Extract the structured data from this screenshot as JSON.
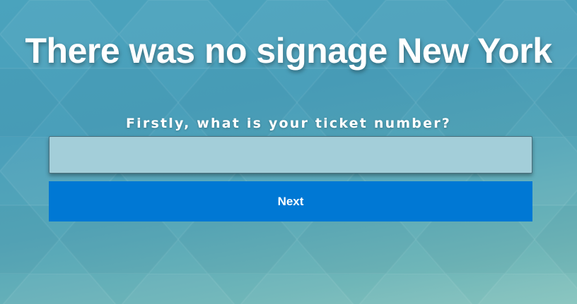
{
  "page": {
    "title": "There was no signage New York"
  },
  "form": {
    "question": "Firstly, what is your ticket number?",
    "ticket_input": {
      "value": "",
      "placeholder": ""
    },
    "next_label": "Next"
  },
  "colors": {
    "background": "#4aa3bd",
    "input_background": "#a3ced9",
    "button": "#0078d4",
    "text": "#ffffff"
  }
}
